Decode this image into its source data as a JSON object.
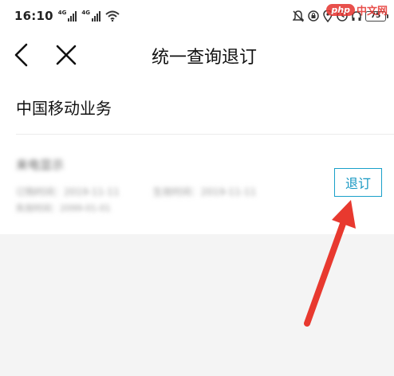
{
  "status_bar": {
    "time": "16:10",
    "signal1_tag": "4G",
    "signal2_tag": "4G",
    "battery": "75"
  },
  "watermark": {
    "logo": "php",
    "text": "中文网"
  },
  "nav": {
    "title": "统一查询退订"
  },
  "section": {
    "title": "中国移动业务"
  },
  "item": {
    "name": "来电显示",
    "line1_left": "订购时间：2019-11-11",
    "line1_right": "生效时间：2019-11-11",
    "line2": "失效时间：2099-01-01",
    "unsubscribe_label": "退订"
  },
  "colors": {
    "accent": "#1597c2",
    "arrow": "#e8392f",
    "background": "#f4f4f4"
  }
}
